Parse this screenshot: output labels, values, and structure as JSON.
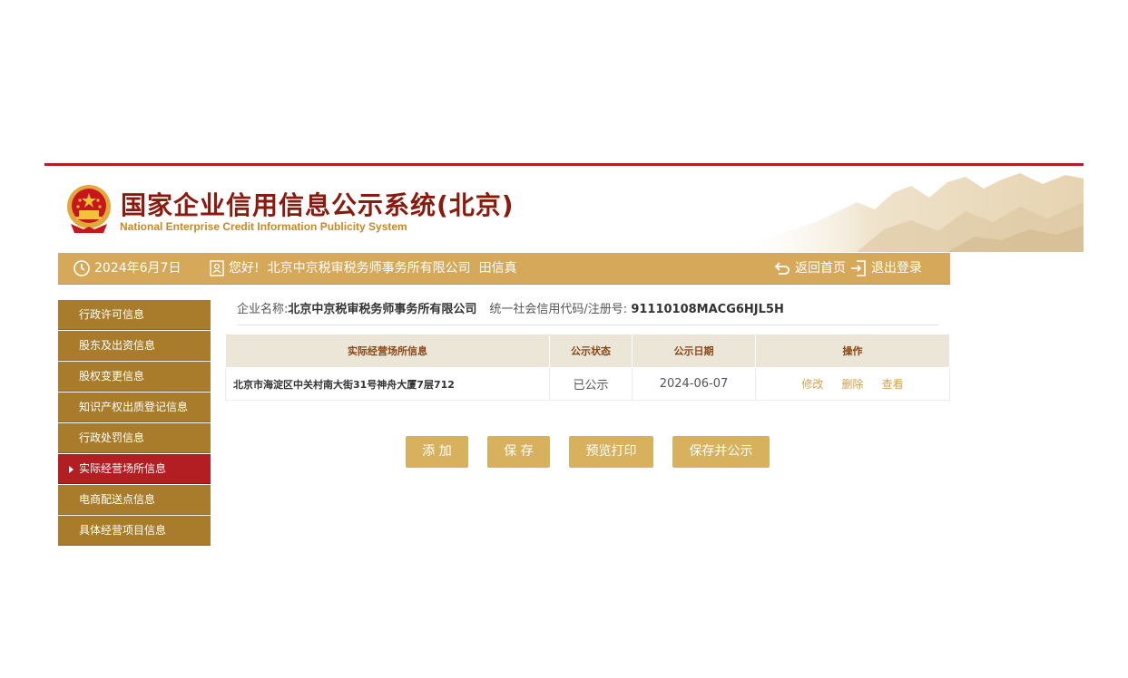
{
  "header": {
    "title_cn": "国家企业信用信息公示系统(北京)",
    "title_en": "National Enterprise Credit Information Publicity System"
  },
  "navbar": {
    "date": "2024年6月7日",
    "greeting": "您好!",
    "user_company": "北京中京税审税务师事务所有限公司",
    "user_name": "田信真",
    "home_label": "返回首页",
    "logout_label": "退出登录"
  },
  "sidebar": {
    "items": [
      {
        "label": "行政许可信息"
      },
      {
        "label": "股东及出资信息"
      },
      {
        "label": "股权变更信息"
      },
      {
        "label": "知识产权出质登记信息"
      },
      {
        "label": "行政处罚信息"
      },
      {
        "label": "实际经营场所信息"
      },
      {
        "label": "电商配送点信息"
      },
      {
        "label": "具体经营项目信息"
      }
    ],
    "active_index": 5
  },
  "company": {
    "name_label": "企业名称:",
    "name": "北京中京税审税务师事务所有限公司",
    "code_label": "统一社会信用代码/注册号:",
    "code": "91110108MACG6HJL5H"
  },
  "table": {
    "headers": [
      "实际经营场所信息",
      "公示状态",
      "公示日期",
      "操作"
    ],
    "rows": [
      {
        "address": "北京市海淀区中关村南大街31号神舟大厦7层712",
        "status": "已公示",
        "date": "2024-06-07",
        "actions": [
          "修改",
          "删除",
          "查看"
        ]
      }
    ]
  },
  "buttons": {
    "add": "添 加",
    "save": "保 存",
    "preview": "预览打印",
    "save_publish": "保存并公示"
  },
  "colors": {
    "brand_red": "#b01f24",
    "gold": "#d6a95a",
    "sidebar": "#a97c2c",
    "active": "#b21e22"
  }
}
